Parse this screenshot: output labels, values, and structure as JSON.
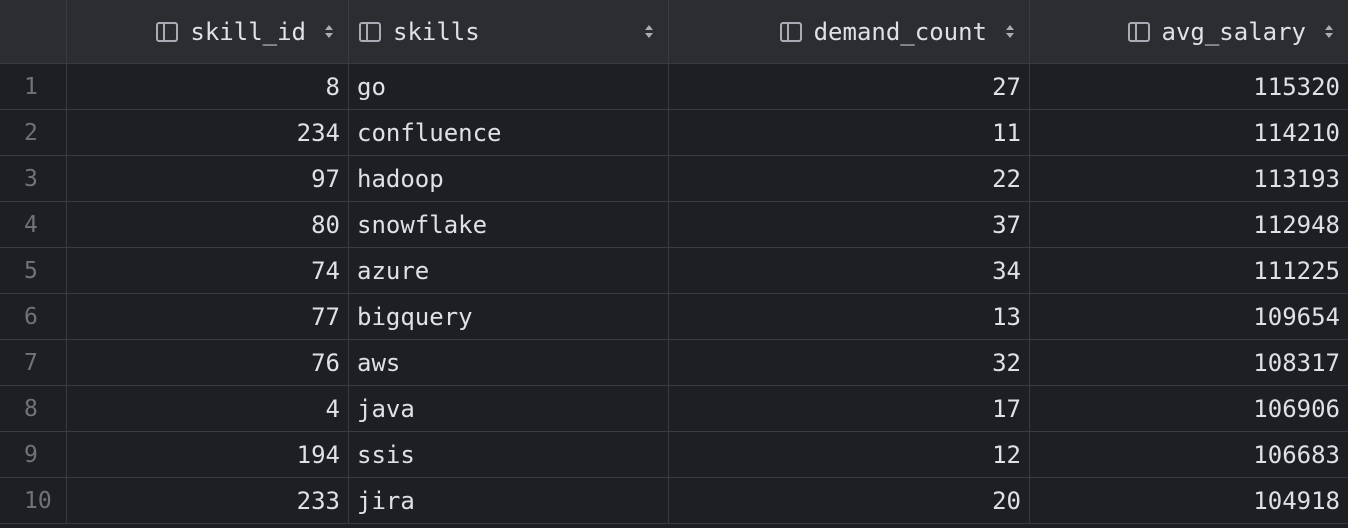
{
  "table": {
    "columns": [
      {
        "label": "skill_id",
        "icon": "column-icon"
      },
      {
        "label": "skills",
        "icon": "column-icon"
      },
      {
        "label": "demand_count",
        "icon": "column-icon"
      },
      {
        "label": "avg_salary",
        "icon": "column-icon"
      }
    ],
    "rows": [
      {
        "n": "1",
        "skill_id": "8",
        "skills": "go",
        "demand_count": "27",
        "avg_salary": "115320"
      },
      {
        "n": "2",
        "skill_id": "234",
        "skills": "confluence",
        "demand_count": "11",
        "avg_salary": "114210"
      },
      {
        "n": "3",
        "skill_id": "97",
        "skills": "hadoop",
        "demand_count": "22",
        "avg_salary": "113193"
      },
      {
        "n": "4",
        "skill_id": "80",
        "skills": "snowflake",
        "demand_count": "37",
        "avg_salary": "112948"
      },
      {
        "n": "5",
        "skill_id": "74",
        "skills": "azure",
        "demand_count": "34",
        "avg_salary": "111225"
      },
      {
        "n": "6",
        "skill_id": "77",
        "skills": "bigquery",
        "demand_count": "13",
        "avg_salary": "109654"
      },
      {
        "n": "7",
        "skill_id": "76",
        "skills": "aws",
        "demand_count": "32",
        "avg_salary": "108317"
      },
      {
        "n": "8",
        "skill_id": "4",
        "skills": "java",
        "demand_count": "17",
        "avg_salary": "106906"
      },
      {
        "n": "9",
        "skill_id": "194",
        "skills": "ssis",
        "demand_count": "12",
        "avg_salary": "106683"
      },
      {
        "n": "10",
        "skill_id": "233",
        "skills": "jira",
        "demand_count": "20",
        "avg_salary": "104918"
      }
    ]
  },
  "colors": {
    "background": "#1e1f22",
    "header_background": "#2b2d30",
    "grid_line": "#393b40",
    "text": "#dfe1e5",
    "row_number": "#6f737a"
  }
}
